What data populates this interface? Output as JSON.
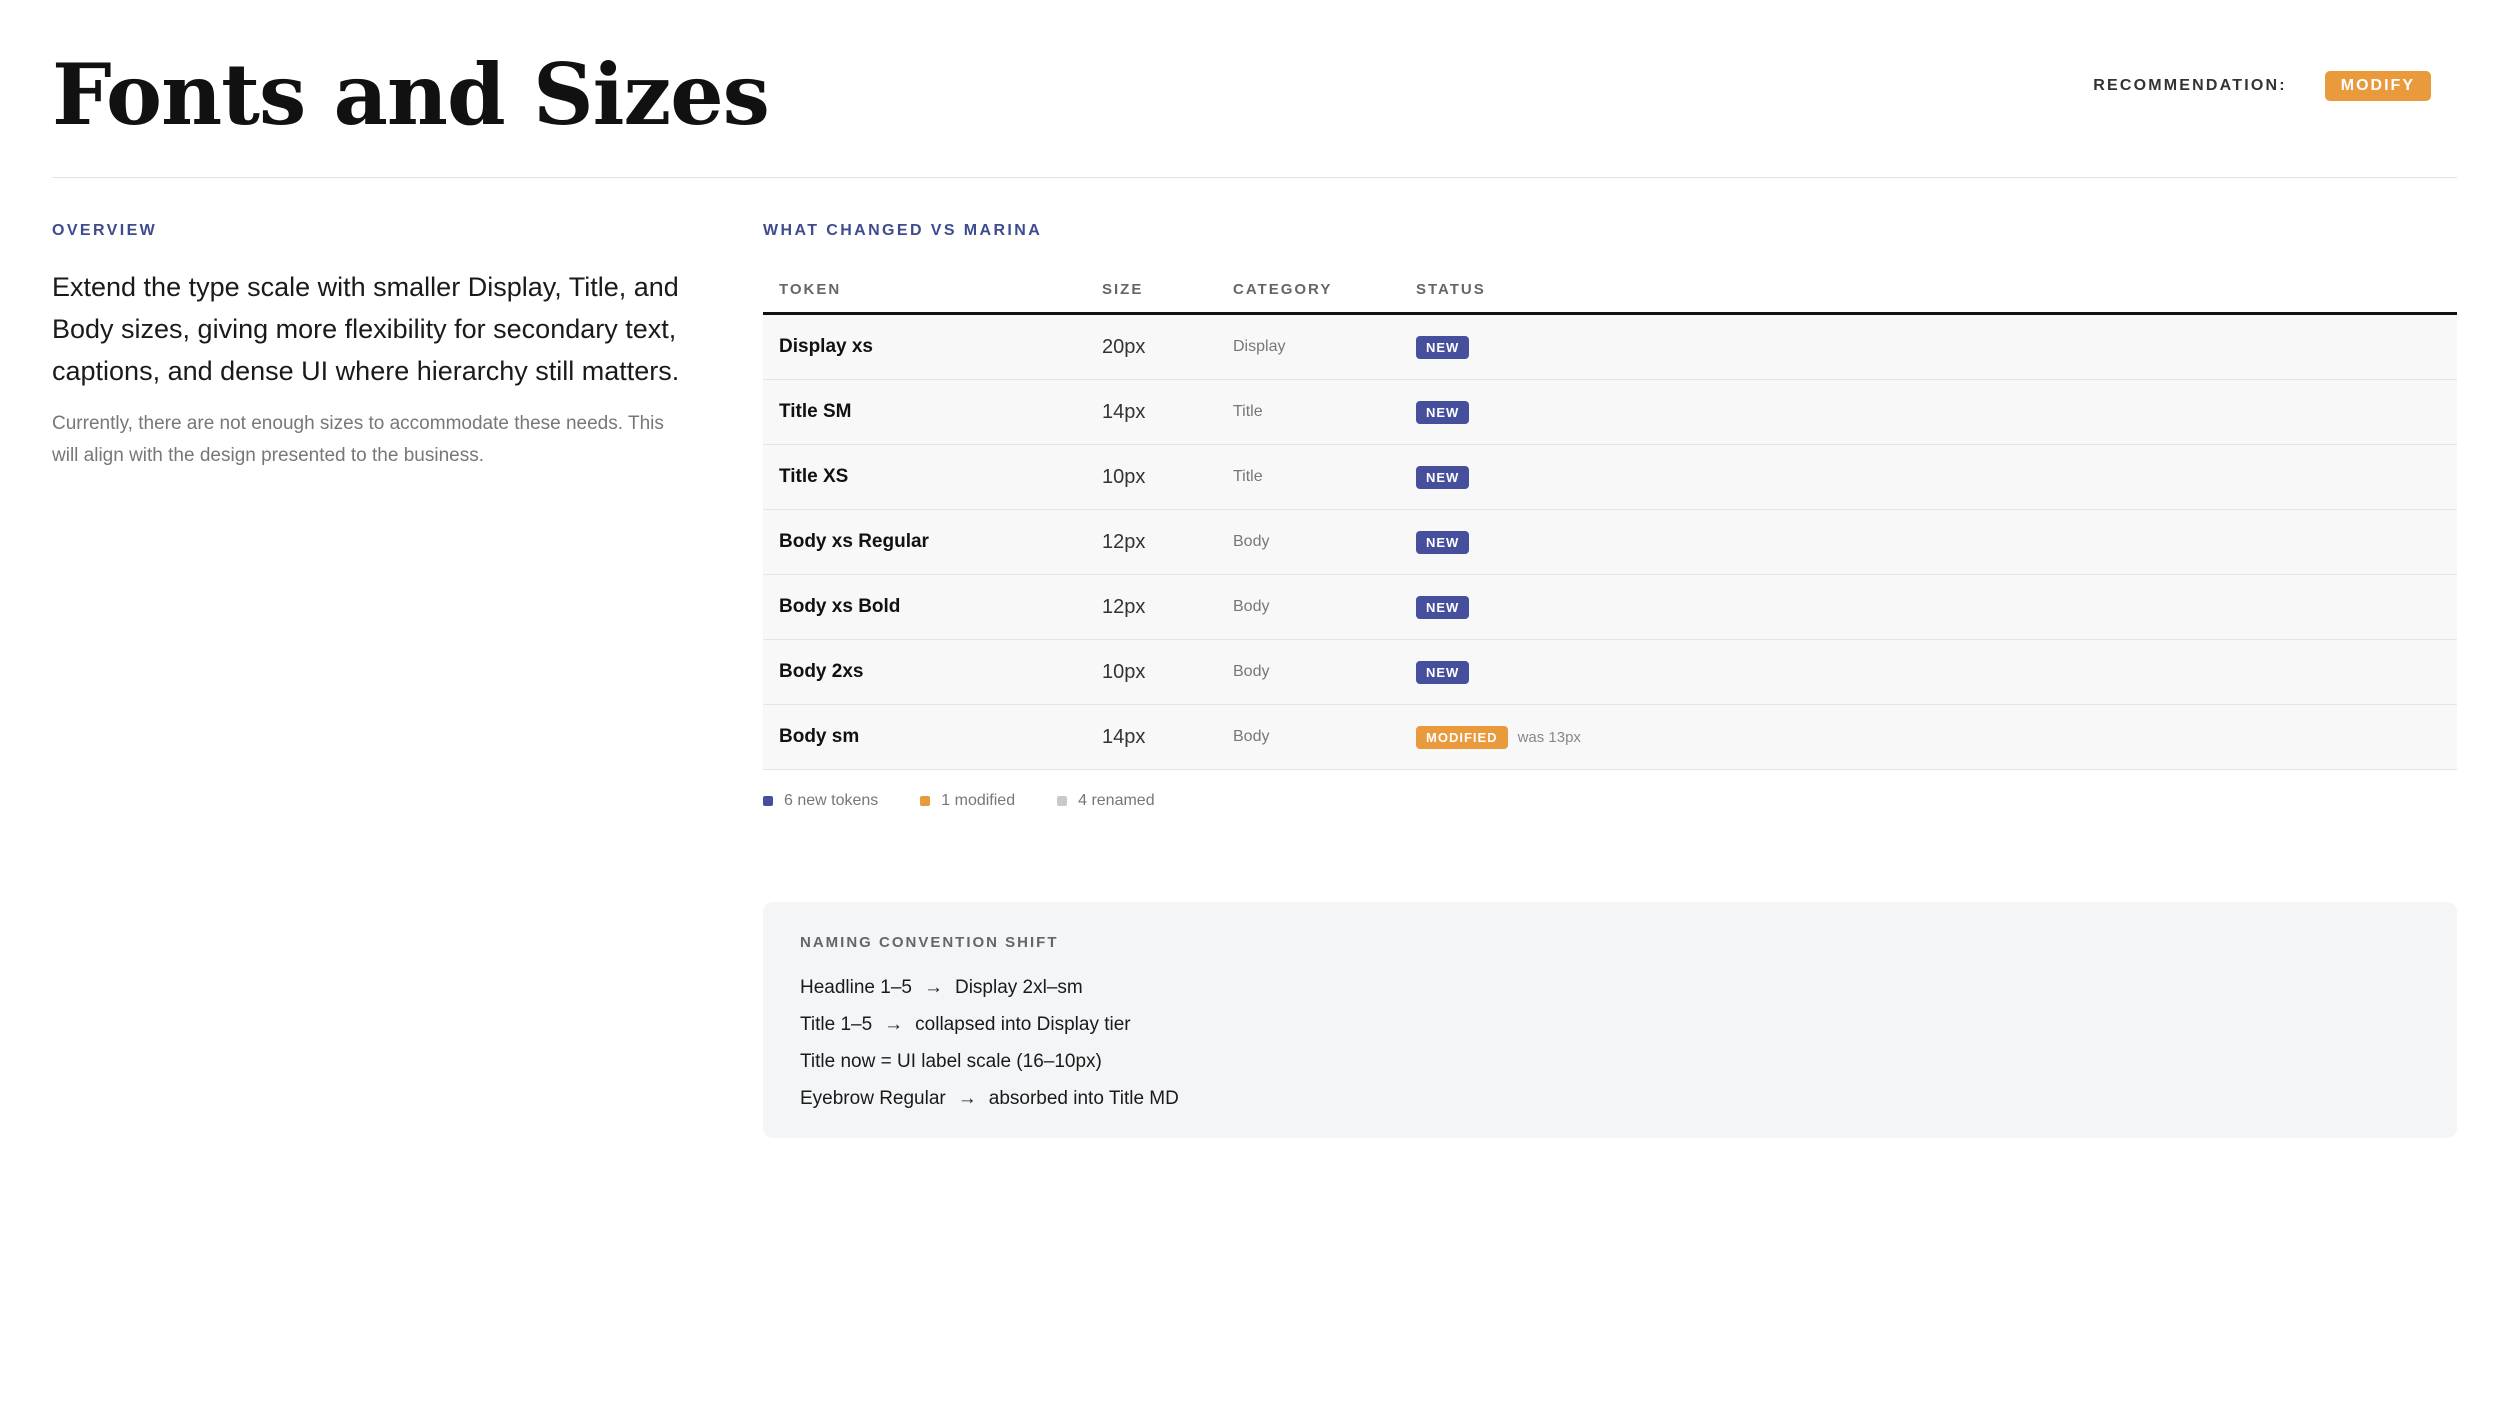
{
  "header": {
    "title": "Fonts and Sizes",
    "recommendation_label": "RECOMMENDATION:",
    "recommendation_value": "MODIFY"
  },
  "overview": {
    "eyebrow": "OVERVIEW",
    "lead": "Extend the type scale with smaller Display, Title, and Body sizes, giving more flexibility for secondary text, captions, and dense UI where hierarchy still matters.",
    "detail": "Currently, there are not enough sizes to accommodate these needs. This will align with the design presented to the business."
  },
  "changes": {
    "eyebrow": "WHAT CHANGED VS MARINA",
    "columns": [
      "TOKEN",
      "SIZE",
      "CATEGORY",
      "STATUS"
    ],
    "rows": [
      {
        "token": "Display xs",
        "size": "20px",
        "category": "Display",
        "status": "NEW",
        "note": ""
      },
      {
        "token": "Title SM",
        "size": "14px",
        "category": "Title",
        "status": "NEW",
        "note": ""
      },
      {
        "token": "Title XS",
        "size": "10px",
        "category": "Title",
        "status": "NEW",
        "note": ""
      },
      {
        "token": "Body xs Regular",
        "size": "12px",
        "category": "Body",
        "status": "NEW",
        "note": ""
      },
      {
        "token": "Body xs Bold",
        "size": "12px",
        "category": "Body",
        "status": "NEW",
        "note": ""
      },
      {
        "token": "Body 2xs",
        "size": "10px",
        "category": "Body",
        "status": "NEW",
        "note": ""
      },
      {
        "token": "Body sm",
        "size": "14px",
        "category": "Body",
        "status": "MODIFIED",
        "note": "was 13px"
      }
    ],
    "legend": [
      {
        "label": "6 new tokens",
        "color": "#454f9c"
      },
      {
        "label": "1 modified",
        "color": "#e89a3c"
      },
      {
        "label": "4 renamed",
        "color": "#c9c9c9"
      }
    ]
  },
  "naming": {
    "title": "NAMING CONVENTION SHIFT",
    "arrow": "→",
    "lines": [
      {
        "from": "Headline 1–5",
        "to": "Display 2xl–sm"
      },
      {
        "from": "Title 1–5",
        "to": "collapsed into Display tier"
      },
      {
        "from": "Title now = UI label scale (16–10px)",
        "to": ""
      },
      {
        "from": "Eyebrow Regular",
        "to": "absorbed into Title MD"
      }
    ]
  },
  "colors": {
    "accent": "#3f4b8f",
    "new": "#454f9c",
    "modified": "#e89a3c"
  }
}
